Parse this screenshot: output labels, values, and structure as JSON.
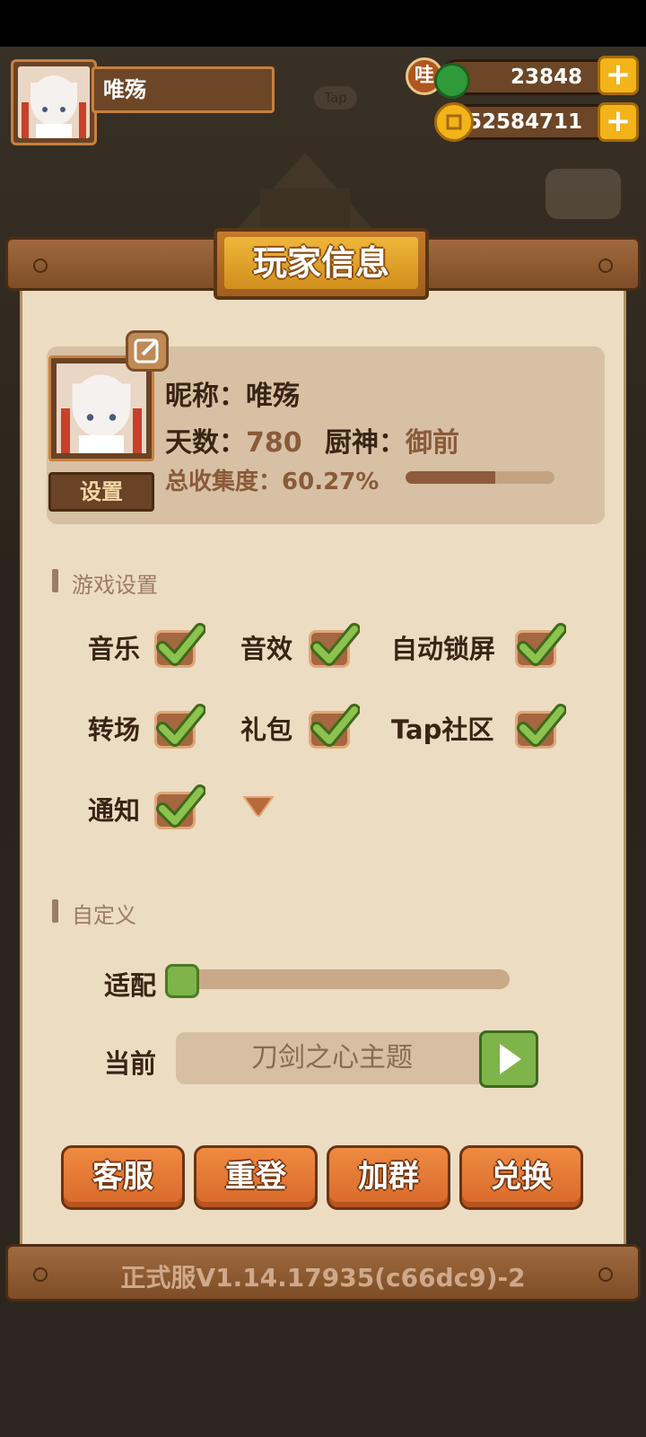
{
  "header": {
    "player_name": "唯殇",
    "wa_label": "哇",
    "jade_count": "23848",
    "coin_count": "52584711",
    "plus_label": "+",
    "tap_badge": "Tap"
  },
  "panel": {
    "title": "玩家信息",
    "profile": {
      "set_label": "设置",
      "nickname_label": "昵称：",
      "nickname_value": "唯殇",
      "days_label": "天数：",
      "days_value": "780",
      "chef_label": "厨神：",
      "chef_value": "御前",
      "collection_label": "总收集度：",
      "collection_value": "60.27%",
      "collection_progress": 0.6027
    },
    "game_settings": {
      "heading": "游戏设置",
      "options": [
        {
          "label": "音乐",
          "checked": true
        },
        {
          "label": "音效",
          "checked": true
        },
        {
          "label": "自动锁屏",
          "checked": true
        },
        {
          "label": "转场",
          "checked": true
        },
        {
          "label": "礼包",
          "checked": true
        },
        {
          "label": "Tap社区",
          "checked": true
        },
        {
          "label": "通知",
          "checked": true
        }
      ]
    },
    "custom": {
      "heading": "自定义",
      "fit_label": "适配",
      "fit_value": 0.0,
      "current_label": "当前",
      "current_theme": "刀剑之心主题"
    },
    "buttons": {
      "service": "客服",
      "relogin": "重登",
      "join_group": "加群",
      "redeem": "兑换"
    },
    "version": "正式服V1.14.17935(c66dc9)-2"
  },
  "colors": {
    "panel": "#ecdcc2",
    "accent_orange": "#e47a36",
    "check_green": "#7fb44b",
    "title_gold": "#f0b63a"
  }
}
